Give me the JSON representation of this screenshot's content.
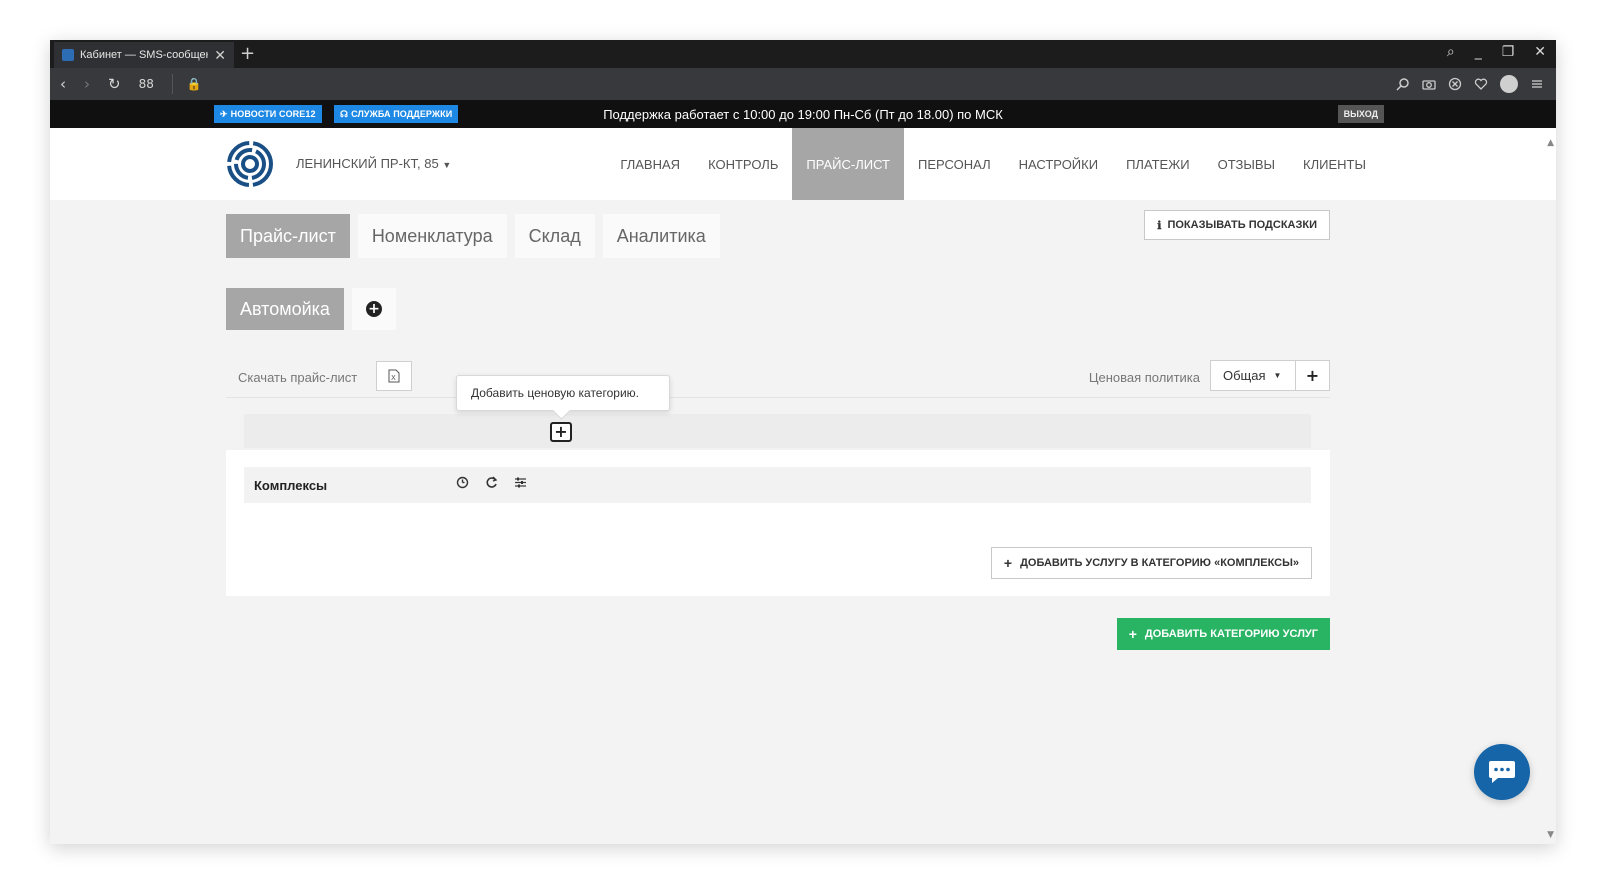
{
  "browser": {
    "tab_title": "Кабинет — SMS-сообщения",
    "new_tab": "+",
    "tab_close": "✕",
    "window_controls": {
      "search": "⌕",
      "minimize": "_",
      "restore": "❐",
      "close": "✕"
    },
    "nav": {
      "back": "‹",
      "forward": "›",
      "reload": "↻",
      "speed_dial": "88",
      "lock": "🔒"
    },
    "toolbar_icons": [
      "zoom-icon",
      "camera-icon",
      "shield-icon",
      "heart-icon",
      "account-icon",
      "settings-icon"
    ]
  },
  "topbar": {
    "news_label": "НОВОСТИ CORE12",
    "support_service_label": "СЛУЖБА ПОДДЕРЖКИ",
    "support_hours": "Поддержка работает с 10:00 до 19:00 Пн-Сб (Пт до 18.00) по МСК",
    "logout_label": "ВЫХОД"
  },
  "header": {
    "branch": "ЛЕНИНСКИЙ ПР-КТ, 85",
    "nav": [
      {
        "label": "ГЛАВНАЯ"
      },
      {
        "label": "КОНТРОЛЬ"
      },
      {
        "label": "ПРАЙС-ЛИСТ"
      },
      {
        "label": "ПЕРСОНАЛ"
      },
      {
        "label": "НАСТРОЙКИ"
      },
      {
        "label": "ПЛАТЕЖИ"
      },
      {
        "label": "ОТЗЫВЫ"
      },
      {
        "label": "КЛИЕНТЫ"
      }
    ]
  },
  "subtabs": [
    {
      "label": "Прайс-лист"
    },
    {
      "label": "Номенклатура"
    },
    {
      "label": "Склад"
    },
    {
      "label": "Аналитика"
    }
  ],
  "hints_button": "ПОКАЗЫВАТЬ ПОДСКАЗКИ",
  "category_tabs": [
    {
      "label": "Автомойка"
    }
  ],
  "download_label": "Скачать прайс-лист",
  "price_policy": {
    "label": "Ценовая политика",
    "selected": "Общая"
  },
  "tooltip": "Добавить ценовую категорию.",
  "category": {
    "name": "Комплексы"
  },
  "add_service_button": "ДОБАВИТЬ УСЛУГУ В КАТЕГОРИЮ «КОМПЛЕКСЫ»",
  "add_category_button": "ДОБАВИТЬ КАТЕГОРИЮ УСЛУГ",
  "colors": {
    "accent_blue": "#1e88e5",
    "active_gray": "#a6a6a6",
    "green": "#28b463",
    "chat_blue": "#1565a8"
  }
}
